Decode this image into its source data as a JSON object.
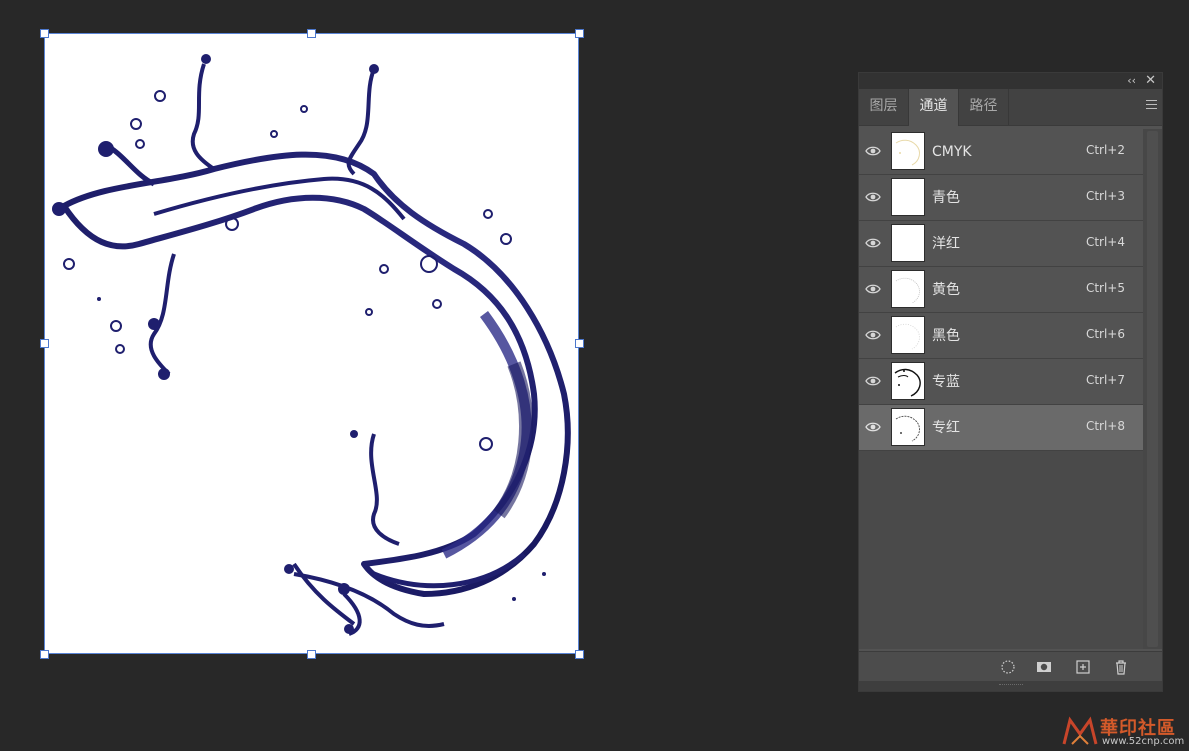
{
  "panel": {
    "tabs": [
      {
        "label": "图层",
        "active": false
      },
      {
        "label": "通道",
        "active": true
      },
      {
        "label": "路径",
        "active": false
      }
    ],
    "channels": [
      {
        "name": "CMYK",
        "shortcut": "Ctrl+2",
        "visible": true,
        "selected": false
      },
      {
        "name": "青色",
        "shortcut": "Ctrl+3",
        "visible": true,
        "selected": false
      },
      {
        "name": "洋红",
        "shortcut": "Ctrl+4",
        "visible": true,
        "selected": false
      },
      {
        "name": "黄色",
        "shortcut": "Ctrl+5",
        "visible": true,
        "selected": false
      },
      {
        "name": "黑色",
        "shortcut": "Ctrl+6",
        "visible": true,
        "selected": false
      },
      {
        "name": "专蓝",
        "shortcut": "Ctrl+7",
        "visible": true,
        "selected": false
      },
      {
        "name": "专红",
        "shortcut": "Ctrl+8",
        "visible": true,
        "selected": true
      }
    ],
    "icons": {
      "collapse": "double-chevron-left-icon",
      "close": "close-icon",
      "menu": "panel-menu-icon",
      "visibility": "eye-icon",
      "load_selection": "dotted-circle-selection-icon",
      "save_selection": "mask-icon",
      "new_channel": "new-channel-icon",
      "delete": "trash-icon"
    }
  },
  "watermark": {
    "title": "華印社區",
    "url": "www.52cnp.com"
  },
  "colors": {
    "workspace": "#282828",
    "panel": "#535353",
    "selected_row": "#6a6a6a",
    "selection_border": "#5b85d6",
    "splash": "#1f1f6e"
  }
}
